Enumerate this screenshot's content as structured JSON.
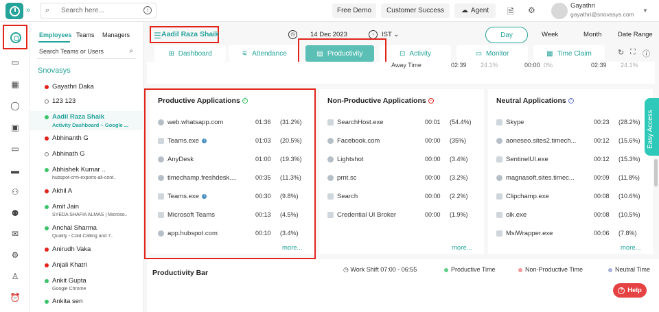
{
  "topbar": {
    "search_placeholder": "Search here...",
    "free_demo": "Free Demo",
    "customer_success": "Customer Success",
    "agent": "Agent",
    "user_name": "Gayathri",
    "user_email": "gayathri@snovasys.com"
  },
  "employees_panel": {
    "tabs": [
      "Employees",
      "Teams",
      "Managers"
    ],
    "search_placeholder": "Search Teams or Users",
    "org_name": "Snovasys",
    "items": [
      {
        "name": "Gayathri Daka",
        "status": "red",
        "sub": ""
      },
      {
        "name": "123 123",
        "status": "hollow",
        "sub": ""
      },
      {
        "name": "Aadil Raza Shaik",
        "status": "green",
        "sub": "Activity Dashboard ~ Google ...",
        "selected": true
      },
      {
        "name": "Abhinanth G",
        "status": "red",
        "sub": ""
      },
      {
        "name": "Abhinath G",
        "status": "hollow",
        "sub": ""
      },
      {
        "name": "Abhishek Kumar ..",
        "status": "green",
        "sub": "hubspot-crm-exports-all-cont.."
      },
      {
        "name": "Akhil A",
        "status": "red",
        "sub": ""
      },
      {
        "name": "Amit Jain",
        "status": "green",
        "sub": "SYEDA SHAFIA ALMAS | Microso.."
      },
      {
        "name": "Anchal Sharma",
        "status": "green",
        "sub": "Quality - Cold Calling and 7.."
      },
      {
        "name": "Anirudh Vaka",
        "status": "red",
        "sub": ""
      },
      {
        "name": "Anjali Khatri",
        "status": "red",
        "sub": ""
      },
      {
        "name": "Ankit Gupta",
        "status": "green",
        "sub": "Google Chrome"
      },
      {
        "name": "Ankita sen",
        "status": "green",
        "sub": ""
      }
    ]
  },
  "header": {
    "person": "Aadil Raza Shaik",
    "date": "14 Dec 2023",
    "timezone": "IST",
    "periods": [
      "Day",
      "Week",
      "Month",
      "Date Range"
    ]
  },
  "nav_tabs": [
    "Dashboard",
    "Attendance",
    "Productivity",
    "Activity",
    "Monitor",
    "Time Claim"
  ],
  "strip": {
    "label": "Away Time",
    "t1": "02:39",
    "p1": "24.1%",
    "t2": "00:00",
    "p2": "0%",
    "t3": "02:39",
    "p3": "24.1%"
  },
  "cards": {
    "productive": {
      "title": "Productive Applications",
      "more": "more...",
      "apps": [
        {
          "name": "web.whatsapp.com",
          "time": "01:36",
          "pct": "(31.2%)"
        },
        {
          "name": "Teams.exe",
          "time": "01:03",
          "pct": "(20.5%)",
          "info": true
        },
        {
          "name": "AnyDesk",
          "time": "01:00",
          "pct": "(19.3%)"
        },
        {
          "name": "timechamp.freshdesk....",
          "time": "00:35",
          "pct": "(11.3%)"
        },
        {
          "name": "Teams.exe",
          "time": "00:30",
          "pct": "(9.8%)",
          "info": true
        },
        {
          "name": "Microsoft Teams",
          "time": "00:13",
          "pct": "(4.5%)"
        },
        {
          "name": "app.hubspot.com",
          "time": "00:10",
          "pct": "(3.4%)"
        }
      ]
    },
    "nonproductive": {
      "title": "Non-Productive Applications",
      "more": "more...",
      "apps": [
        {
          "name": "SearchHost.exe",
          "time": "00:01",
          "pct": "(54.4%)"
        },
        {
          "name": "Facebook.com",
          "time": "00:00",
          "pct": "(35%)"
        },
        {
          "name": "Lightshot",
          "time": "00:00",
          "pct": "(3.4%)"
        },
        {
          "name": "prnt.sc",
          "time": "00:00",
          "pct": "(3.2%)"
        },
        {
          "name": "Search",
          "time": "00:00",
          "pct": "(2.2%)"
        },
        {
          "name": "Credential UI Broker",
          "time": "00:00",
          "pct": "(1.9%)"
        }
      ]
    },
    "neutral": {
      "title": "Neutral Applications",
      "more": "more...",
      "apps": [
        {
          "name": "Skype",
          "time": "00:23",
          "pct": "(28.2%)"
        },
        {
          "name": "aoneseo.sites2.timech...",
          "time": "00:12",
          "pct": "(15.6%)"
        },
        {
          "name": "SentinelUI.exe",
          "time": "00:12",
          "pct": "(15.3%)"
        },
        {
          "name": "magnasoft.sites.timec...",
          "time": "00:09",
          "pct": "(11.8%)"
        },
        {
          "name": "Clipchamp.exe",
          "time": "00:08",
          "pct": "(10.6%)"
        },
        {
          "name": "olk.exe",
          "time": "00:08",
          "pct": "(10.5%)"
        },
        {
          "name": "MsiWrapper.exe",
          "time": "00:06",
          "pct": "(7.8%)"
        }
      ]
    }
  },
  "productivity_bar": {
    "title": "Productivity Bar",
    "work_shift": "Work Shift 07:00 - 06:55",
    "legend": [
      {
        "label": "Productive Time",
        "color": "#5fcf8a"
      },
      {
        "label": "Non-Productive Time",
        "color": "#f29a9a"
      },
      {
        "label": "Neutral Time",
        "color": "#a7b0d8"
      }
    ]
  },
  "easy_access": "Easy Access",
  "help": "Help",
  "colors": {
    "brand": "#25a39a",
    "highlight": "#e2231a"
  }
}
